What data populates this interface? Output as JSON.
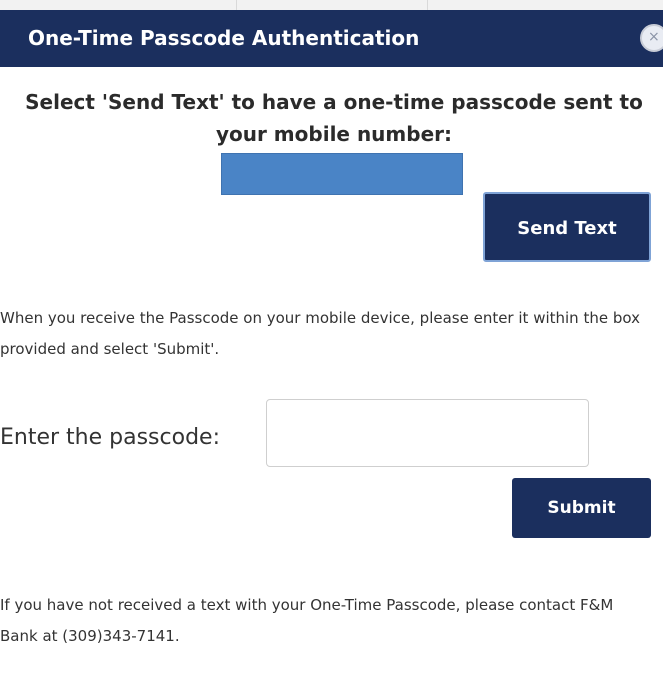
{
  "dialog": {
    "title": "One-Time Passcode Authentication",
    "close_icon": "close-circle-icon",
    "close_glyph": "×"
  },
  "send_section": {
    "instruction": "Select 'Send Text' to have a one-time passcode sent to your mobile number:",
    "phone_number_redacted": true,
    "send_button_label": "Send Text"
  },
  "verify_section": {
    "info": "When you receive the Passcode on your mobile device, please enter it within the box provided and select 'Submit'.",
    "passcode_label": "Enter the passcode:",
    "passcode_value": "",
    "passcode_placeholder": "",
    "submit_button_label": "Submit"
  },
  "footer": {
    "help_text": "If you have not received a text with your One-Time Passcode, please contact F&M Bank at (309)343-7141."
  },
  "colors": {
    "header_bg": "#1b2f5e",
    "button_bg": "#1b2f5e",
    "redaction": "#4a84c6"
  }
}
